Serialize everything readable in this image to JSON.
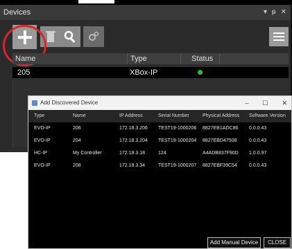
{
  "devices_panel": {
    "title": "Devices",
    "header_controls": [
      "▾",
      "ᵽ",
      "✕"
    ],
    "columns": [
      "Name",
      "Type",
      "Status"
    ],
    "rows": [
      {
        "name": "205",
        "type": "XBox-IP",
        "status_color": "#2ec02e"
      }
    ],
    "toolbar_icons": [
      "add-icon",
      "delete-icon",
      "search-icon",
      "settings-icon",
      "menu-icon"
    ]
  },
  "dialog": {
    "title": "Add Discovered Device",
    "window_controls": [
      "–",
      "☐",
      "✕"
    ],
    "columns": [
      "Type",
      "Name",
      "IP Address",
      "Serial Number",
      "Physical Address",
      "Software Version"
    ],
    "rows": [
      [
        "EVO-IP",
        "206",
        "172.18.3.206",
        "TEST19-1000206",
        "8827EB1ADC86",
        "0.0.0.43"
      ],
      [
        "EVO-IP",
        "204",
        "172.18.3.204",
        "TEST19-1000204",
        "8827EBD47508",
        "0.0.0.43"
      ],
      [
        "HC-IP",
        "My Controller",
        "172.18.3.18",
        "124",
        "A4ADB837F90D",
        "1.0.0.97"
      ],
      [
        "EVO-IP",
        "208",
        "172.18.3.34",
        "TEST19-1000207",
        "8827EBF39C54",
        "0.0.0.43"
      ]
    ],
    "buttons": {
      "manual": "Add Manual Device",
      "close": "CLOSE"
    }
  },
  "colors": {
    "highlight": "#d7262b",
    "status_online": "#2ec02e"
  }
}
